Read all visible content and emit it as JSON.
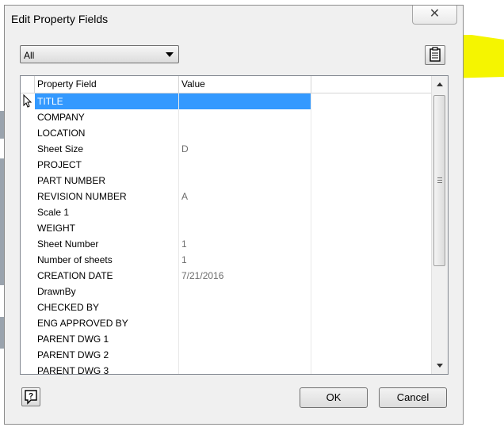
{
  "colors": {
    "highlight": "#f5f500",
    "selection": "#3399ff",
    "dialog_bg": "#f0f0f0"
  },
  "dialog": {
    "title": "Edit Property Fields",
    "close_symbol": "✕"
  },
  "filter": {
    "selected": "All"
  },
  "toolbar": {
    "clipboard_icon": "clipboard-icon"
  },
  "grid": {
    "columns": [
      "Property Field",
      "Value"
    ],
    "rows": [
      {
        "field": "TITLE",
        "value": ""
      },
      {
        "field": "COMPANY",
        "value": ""
      },
      {
        "field": "LOCATION",
        "value": ""
      },
      {
        "field": "Sheet Size",
        "value": "D"
      },
      {
        "field": "PROJECT",
        "value": ""
      },
      {
        "field": "PART NUMBER",
        "value": ""
      },
      {
        "field": "REVISION NUMBER",
        "value": "A"
      },
      {
        "field": "Scale 1",
        "value": ""
      },
      {
        "field": "WEIGHT",
        "value": ""
      },
      {
        "field": "Sheet Number",
        "value": "1"
      },
      {
        "field": "Number of sheets",
        "value": "1"
      },
      {
        "field": "CREATION DATE",
        "value": "7/21/2016"
      },
      {
        "field": "DrawnBy",
        "value": ""
      },
      {
        "field": "CHECKED BY",
        "value": ""
      },
      {
        "field": "ENG APPROVED BY",
        "value": ""
      },
      {
        "field": "PARENT DWG 1",
        "value": ""
      },
      {
        "field": "PARENT DWG 2",
        "value": ""
      },
      {
        "field": "PARENT DWG 3",
        "value": ""
      }
    ],
    "selected_index": 0
  },
  "buttons": {
    "help_icon": "help-icon",
    "ok": "OK",
    "cancel": "Cancel"
  }
}
